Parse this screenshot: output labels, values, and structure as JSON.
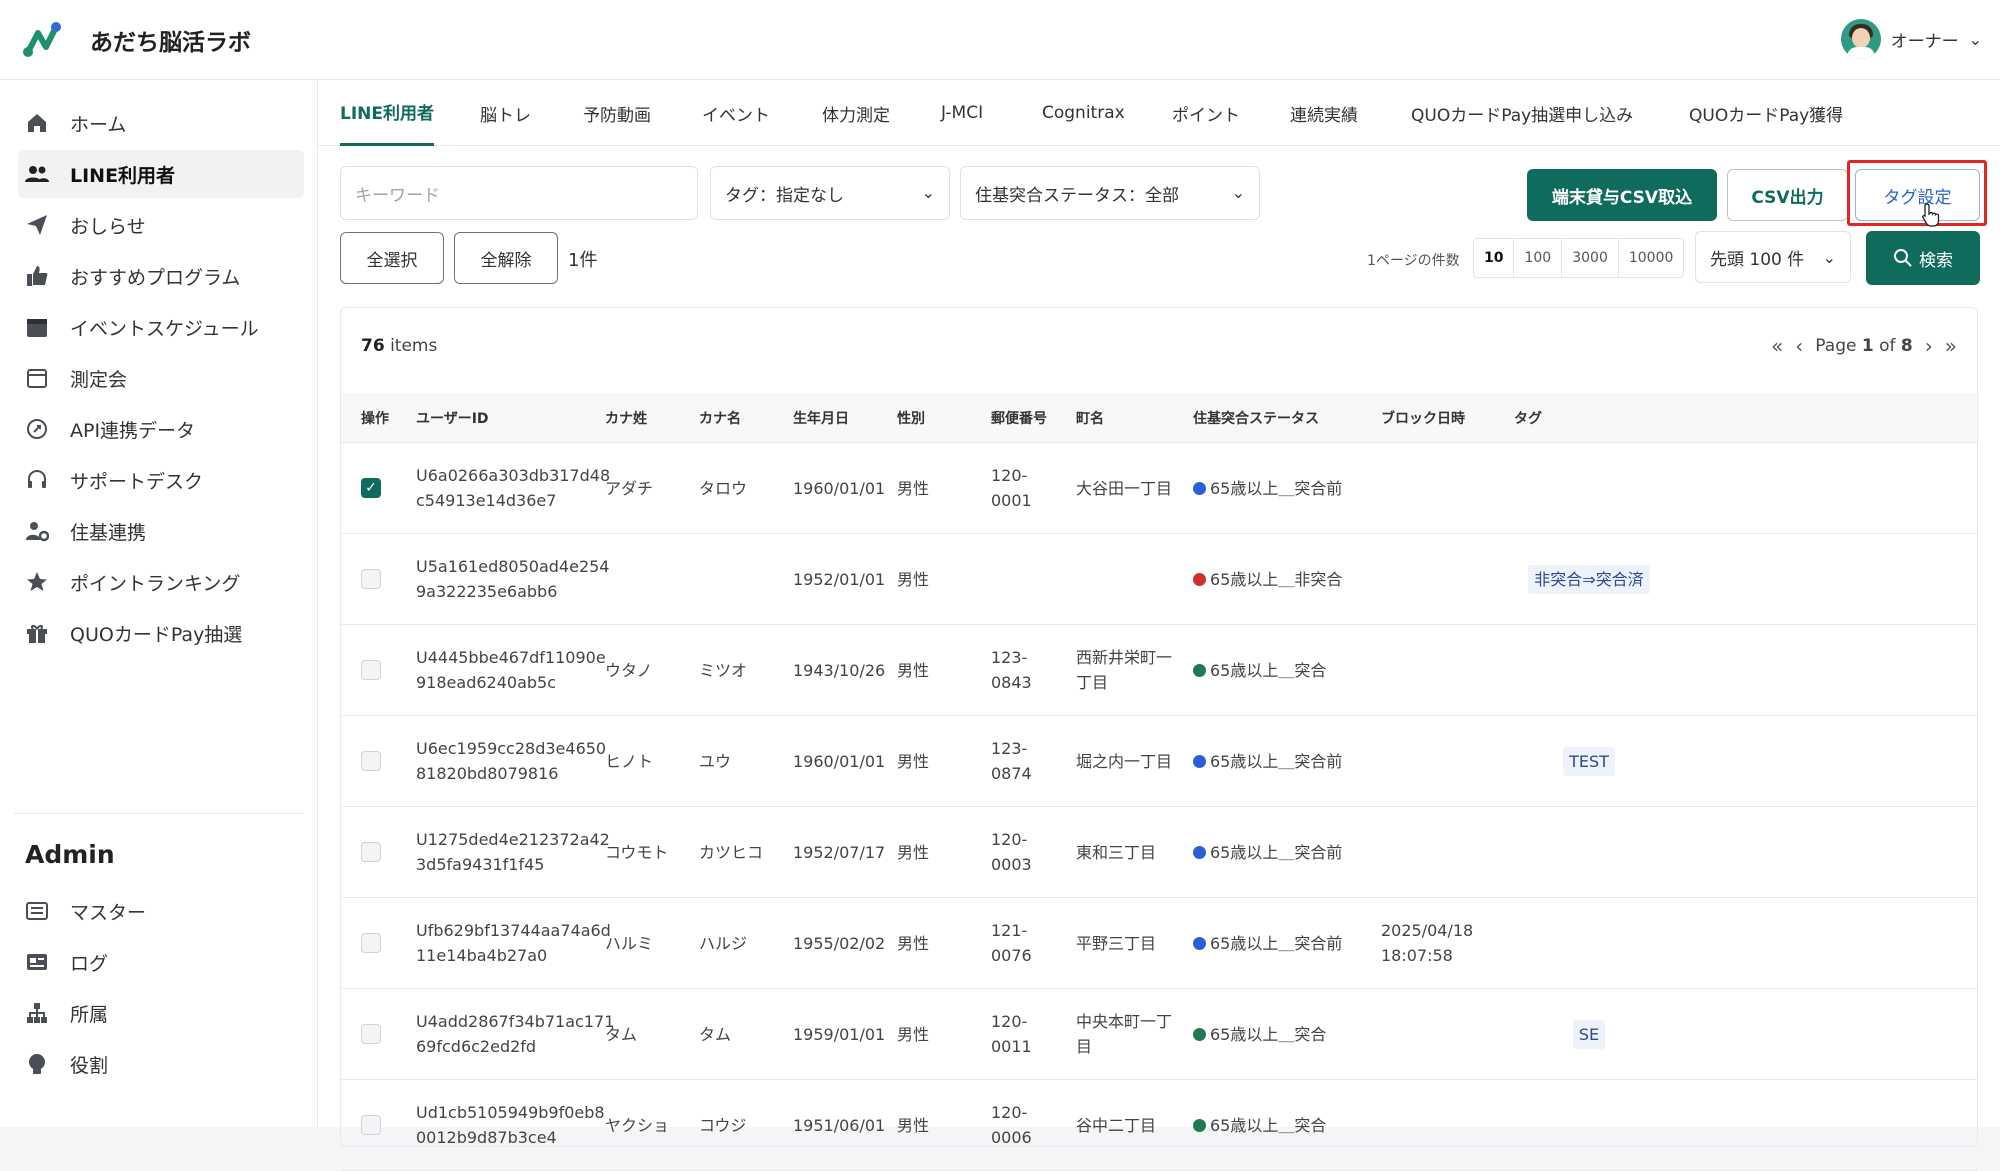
{
  "app": {
    "name": "あだち脳活ラボ",
    "user_label": "オーナー"
  },
  "colors": {
    "accent": "#0f6b5c",
    "blue_dot": "#2b5fd9",
    "red_dot": "#d0302a",
    "green_dot": "#1f7a54",
    "highlight": "#e3261f"
  },
  "sidebar": {
    "items": [
      {
        "label": "ホーム",
        "icon": "home-icon"
      },
      {
        "label": "LINE利用者",
        "icon": "users-icon"
      },
      {
        "label": "おしらせ",
        "icon": "paper-plane-icon"
      },
      {
        "label": "おすすめプログラム",
        "icon": "thumbs-up-icon"
      },
      {
        "label": "イベントスケジュール",
        "icon": "calendar-icon"
      },
      {
        "label": "測定会",
        "icon": "calendar-outline-icon"
      },
      {
        "label": "API連携データ",
        "icon": "api-icon"
      },
      {
        "label": "サポートデスク",
        "icon": "headset-icon"
      },
      {
        "label": "住基連携",
        "icon": "user-gear-icon"
      },
      {
        "label": "ポイントランキング",
        "icon": "star-icon"
      },
      {
        "label": "QUOカードPay抽選",
        "icon": "gift-icon"
      }
    ],
    "admin_heading": "Admin",
    "admin_items": [
      {
        "label": "マスター",
        "icon": "list-icon"
      },
      {
        "label": "ログ",
        "icon": "log-icon"
      },
      {
        "label": "所属",
        "icon": "org-icon"
      },
      {
        "label": "役割",
        "icon": "role-icon"
      }
    ]
  },
  "tabs": [
    "LINE利用者",
    "脳トレ",
    "予防動画",
    "イベント",
    "体力測定",
    "J-MCI",
    "Cognitrax",
    "ポイント",
    "連続実績",
    "QUOカードPay抽選申し込み",
    "QUOカードPay獲得"
  ],
  "filters": {
    "keyword_placeholder": "キーワード",
    "tag_select": "タグ：指定なし",
    "status_select": "住基突合ステータス：全部"
  },
  "actions": {
    "csv_import": "端末貸与CSV取込",
    "csv_export": "CSV出力",
    "tag_settings": "タグ設定",
    "select_all": "全選択",
    "deselect_all": "全解除",
    "selected_count": "1件",
    "per_page_label": "1ページの件数",
    "per_page_options": [
      "10",
      "100",
      "3000",
      "10000"
    ],
    "head_select": "先頭 100 件",
    "search": "検索"
  },
  "table": {
    "items_count": "76",
    "items_suffix": "items",
    "page_prefix": "Page",
    "page_current": "1",
    "page_of": "of",
    "page_total": "8",
    "headers": [
      "操作",
      "ユーザーID",
      "カナ姓",
      "カナ名",
      "生年月日",
      "性別",
      "郵便番号",
      "町名",
      "住基突合ステータス",
      "ブロック日時",
      "タグ"
    ],
    "rows": [
      {
        "checked": true,
        "id1": "U6a0266a303db317d48",
        "id2": "c54913e14d36e7",
        "kana_sei": "アダチ",
        "kana_mei": "タロウ",
        "dob": "1960/01/01",
        "sex": "男性",
        "zip1": "120-",
        "zip2": "0001",
        "town1": "大谷田一丁目",
        "town2": "",
        "status": "65歳以上＿突合前",
        "dot": "blue",
        "block1": "",
        "block2": "",
        "tag": ""
      },
      {
        "checked": false,
        "id1": "U5a161ed8050ad4e254",
        "id2": "9a322235e6abb6",
        "kana_sei": "",
        "kana_mei": "",
        "dob": "1952/01/01",
        "sex": "男性",
        "zip1": "",
        "zip2": "",
        "town1": "",
        "town2": "",
        "status": "65歳以上＿非突合",
        "dot": "red",
        "block1": "",
        "block2": "",
        "tag": "非突合⇒突合済"
      },
      {
        "checked": false,
        "id1": "U4445bbe467df11090e",
        "id2": "918ead6240ab5c",
        "kana_sei": "ウタノ",
        "kana_mei": "ミツオ",
        "dob": "1943/10/26",
        "sex": "男性",
        "zip1": "123-",
        "zip2": "0843",
        "town1": "西新井栄町一",
        "town2": "丁目",
        "status": "65歳以上＿突合",
        "dot": "green",
        "block1": "",
        "block2": "",
        "tag": ""
      },
      {
        "checked": false,
        "id1": "U6ec1959cc28d3e4650",
        "id2": "81820bd8079816",
        "kana_sei": "ヒノト",
        "kana_mei": "ユウ",
        "dob": "1960/01/01",
        "sex": "男性",
        "zip1": "123-",
        "zip2": "0874",
        "town1": "堀之内一丁目",
        "town2": "",
        "status": "65歳以上＿突合前",
        "dot": "blue",
        "block1": "",
        "block2": "",
        "tag": "TEST"
      },
      {
        "checked": false,
        "id1": "U1275ded4e212372a42",
        "id2": "3d5fa9431f1f45",
        "kana_sei": "コウモト",
        "kana_mei": "カツヒコ",
        "dob": "1952/07/17",
        "sex": "男性",
        "zip1": "120-",
        "zip2": "0003",
        "town1": "東和三丁目",
        "town2": "",
        "status": "65歳以上＿突合前",
        "dot": "blue",
        "block1": "",
        "block2": "",
        "tag": ""
      },
      {
        "checked": false,
        "id1": "Ufb629bf13744aa74a6d",
        "id2": "11e14ba4b27a0",
        "kana_sei": "ハルミ",
        "kana_mei": "ハルジ",
        "dob": "1955/02/02",
        "sex": "男性",
        "zip1": "121-",
        "zip2": "0076",
        "town1": "平野三丁目",
        "town2": "",
        "status": "65歳以上＿突合前",
        "dot": "blue",
        "block1": "2025/04/18",
        "block2": "18:07:58",
        "tag": ""
      },
      {
        "checked": false,
        "id1": "U4add2867f34b71ac171",
        "id2": "69fcd6c2ed2fd",
        "kana_sei": "タム",
        "kana_mei": "タム",
        "dob": "1959/01/01",
        "sex": "男性",
        "zip1": "120-",
        "zip2": "0011",
        "town1": "中央本町一丁",
        "town2": "目",
        "status": "65歳以上＿突合",
        "dot": "green",
        "block1": "",
        "block2": "",
        "tag": "SE"
      },
      {
        "checked": false,
        "id1": "Ud1cb5105949b9f0eb8",
        "id2": "0012b9d87b3ce4",
        "kana_sei": "ヤクショ",
        "kana_mei": "コウジ",
        "dob": "1951/06/01",
        "sex": "男性",
        "zip1": "120-",
        "zip2": "0006",
        "town1": "谷中二丁目",
        "town2": "",
        "status": "65歳以上＿突合",
        "dot": "green",
        "block1": "",
        "block2": "",
        "tag": ""
      }
    ]
  }
}
